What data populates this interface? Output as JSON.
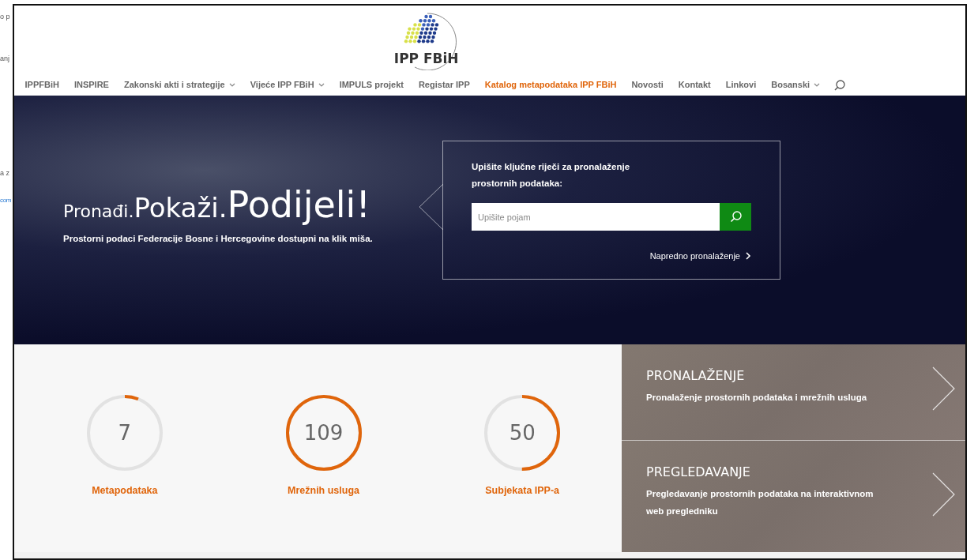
{
  "background_window": {
    "fragments": [
      {
        "text": "o p",
        "kind": "plain"
      },
      {
        "text": "anj",
        "kind": "plain"
      },
      {
        "text": "a z",
        "kind": "plain"
      },
      {
        "text": "com",
        "kind": "link"
      }
    ]
  },
  "logo": {
    "text": "IPP FBiH"
  },
  "nav": {
    "items": [
      {
        "label": "IPPFBiH",
        "dropdown": false,
        "selected": false
      },
      {
        "label": "INSPIRE",
        "dropdown": false,
        "selected": false
      },
      {
        "label": "Zakonski akti i strategije",
        "dropdown": true,
        "selected": false
      },
      {
        "label": "Vijeće IPP FBiH",
        "dropdown": true,
        "selected": false
      },
      {
        "label": "IMPULS projekt",
        "dropdown": false,
        "selected": false
      },
      {
        "label": "Registar IPP",
        "dropdown": false,
        "selected": false
      },
      {
        "label": "Katalog metapodataka IPP FBiH",
        "dropdown": false,
        "selected": true
      },
      {
        "label": "Novosti",
        "dropdown": false,
        "selected": false
      },
      {
        "label": "Kontakt",
        "dropdown": false,
        "selected": false
      },
      {
        "label": "Linkovi",
        "dropdown": false,
        "selected": false
      },
      {
        "label": "Bosanski",
        "dropdown": true,
        "selected": false
      }
    ]
  },
  "hero": {
    "tagline": [
      "Pronađi.",
      "Pokaži.",
      "Podijeli!"
    ],
    "subtitle": "Prostorni podaci Federacije Bosne i Hercegovine dostupni na klik miša.",
    "search": {
      "prompt": "Upišite ključne riječi za pronalaženje prostornih podataka:",
      "placeholder": "Upišite pojam",
      "advanced_link": "Napredno pronalaženje"
    }
  },
  "stats": [
    {
      "value": "7",
      "label": "Metapodataka",
      "level": 0.06
    },
    {
      "value": "109",
      "label": "Mrežnih usluga",
      "level": 1
    },
    {
      "value": "50",
      "label": "Subjekata IPP-a",
      "level": 0.5
    }
  ],
  "features": [
    {
      "title": "PRONALAŽENJE",
      "description": "Pronalaženje prostornih podataka i mrežnih usluga"
    },
    {
      "title": "PREGLEDAVANJE",
      "description": "Pregledavanje prostornih podataka na interaktivnom web pregledniku"
    }
  ]
}
